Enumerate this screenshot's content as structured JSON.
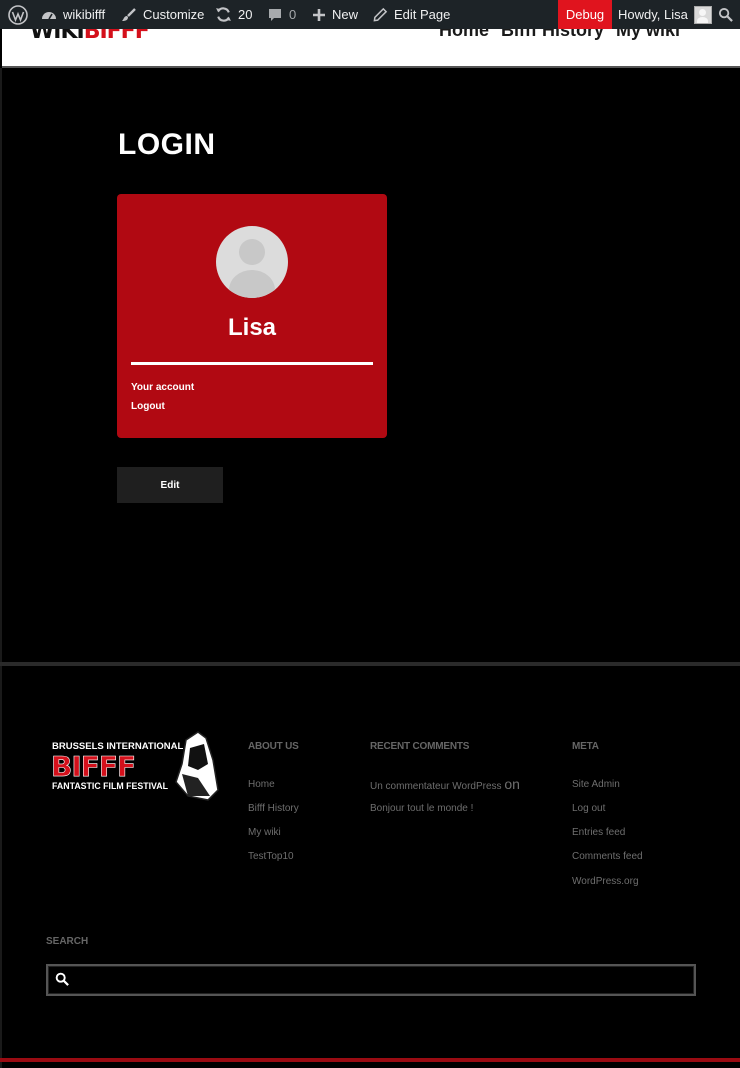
{
  "adminbar": {
    "site_name": "wikibifff",
    "customize_label": "Customize",
    "updates_count": "20",
    "comments_count": "0",
    "new_label": "New",
    "edit_page_label": "Edit Page",
    "debug_label": "Debug",
    "howdy_label": "Howdy, Lisa",
    "colors": {
      "background": "#1d2327",
      "debug": "#e0141e"
    }
  },
  "header": {
    "logo_wiki": "WIKI",
    "logo_bifff": "BIFFF",
    "nav": [
      "Home",
      "Bifff History",
      "My wiki"
    ]
  },
  "main": {
    "title": "LOGIN",
    "card": {
      "user_name": "Lisa",
      "links": [
        "Your account",
        "Logout"
      ],
      "color": "#b10912"
    },
    "edit_label": "Edit"
  },
  "footer": {
    "logo": {
      "line1": "BRUSSELS INTERNATIONAL",
      "word": "BIFFF",
      "line2": "FANTASTIC FILM FESTIVAL"
    },
    "about": {
      "title": "ABOUT US",
      "links": [
        "Home",
        "Bifff History",
        "My wiki",
        "TestTop10"
      ]
    },
    "recent_comments": {
      "title": "RECENT COMMENTS",
      "author": "Un commentateur WordPress",
      "on": "on",
      "post": "Bonjour tout le monde !"
    },
    "meta": {
      "title": "META",
      "links": [
        "Site Admin",
        "Log out",
        "Entries feed",
        "Comments feed",
        "WordPress.org"
      ]
    },
    "search": {
      "title": "SEARCH",
      "placeholder": ""
    }
  }
}
